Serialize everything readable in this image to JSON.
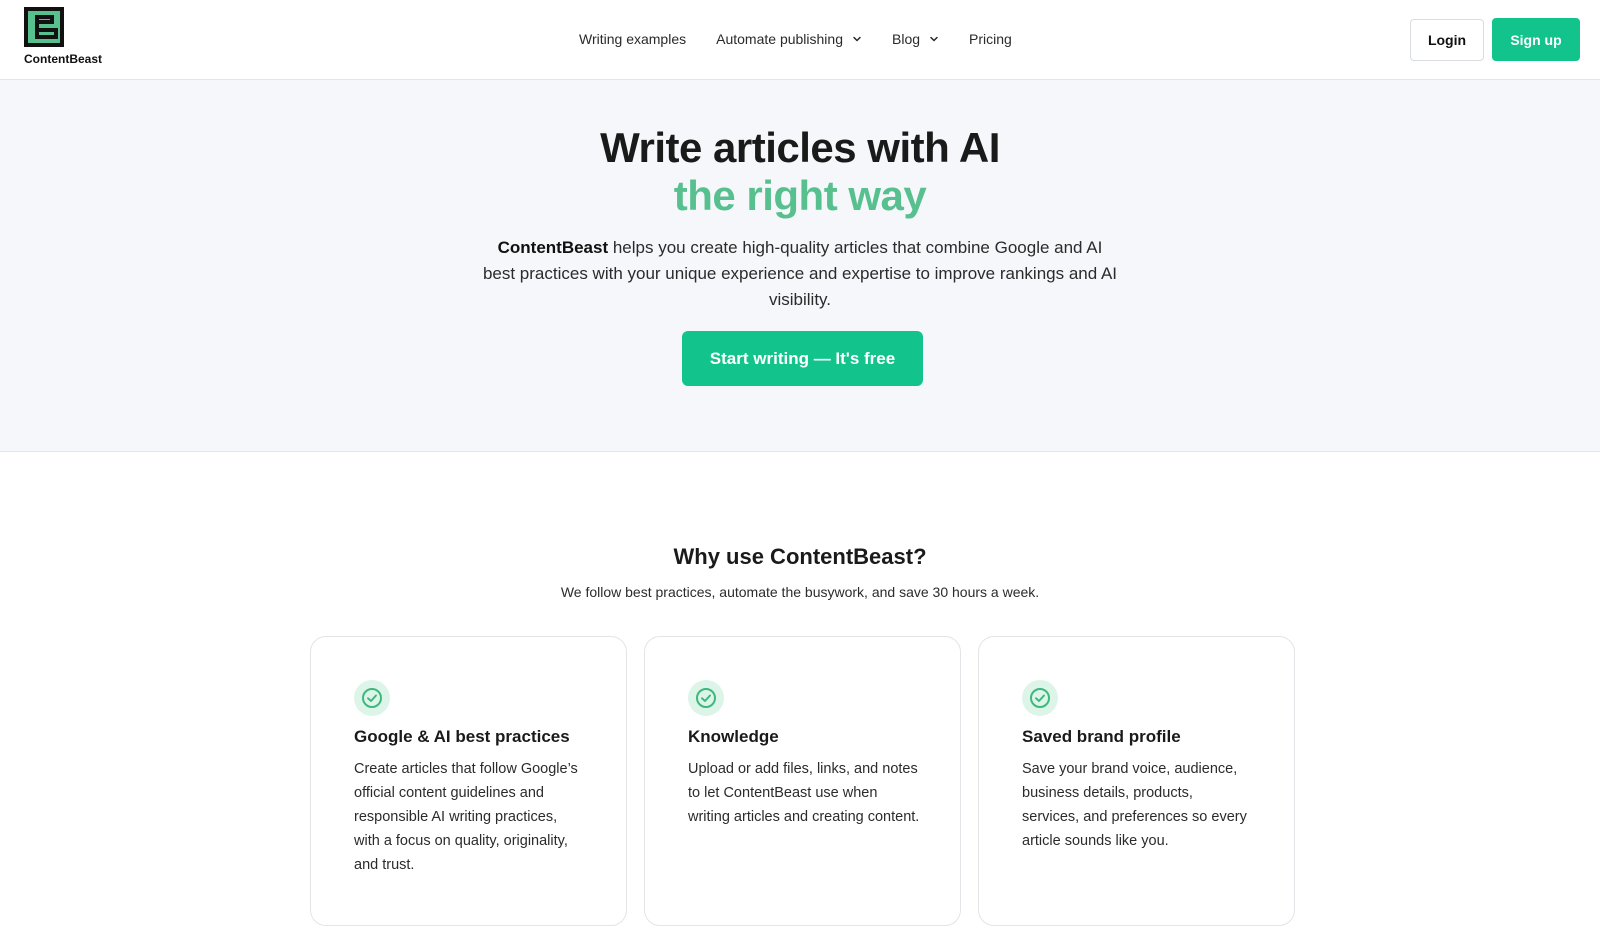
{
  "brand": {
    "name": "ContentBeast",
    "color": "#12c48b",
    "logo_icon": "contentbeast-logo-icon"
  },
  "nav": {
    "items": [
      {
        "label": "Writing examples",
        "has_dropdown": false
      },
      {
        "label": "Automate publishing",
        "has_dropdown": true
      },
      {
        "label": "Blog",
        "has_dropdown": true
      },
      {
        "label": "Pricing",
        "has_dropdown": false
      }
    ],
    "login_label": "Login",
    "signup_label": "Sign up"
  },
  "hero": {
    "title": "Write articles with AI",
    "subtitle": "the right way",
    "subtitle_color": "#58c08f",
    "description_brand": "ContentBeast",
    "description_rest": " helps you create high-quality articles that combine Google and AI best practices with your unique experience and expertise to improve rankings and AI visibility.",
    "cta_label": "Start writing — It's free"
  },
  "why": {
    "title": "Why use ContentBeast?",
    "subtitle": "We follow best practices, automate the busywork, and save 30 hours a week.",
    "cards": [
      {
        "icon": "check-circle-icon",
        "title": "Google & AI best practices",
        "text": "Create articles that follow Google’s official content guidelines and responsible AI writing practices, with a focus on quality, originality, and trust."
      },
      {
        "icon": "check-circle-icon",
        "title": "Knowledge",
        "text": "Upload or add files, links, and notes to let ContentBeast use when writing articles and creating content."
      },
      {
        "icon": "check-circle-icon",
        "title": "Saved brand profile",
        "text": "Save your brand voice, audience, business details, products, services, and preferences so every article sounds like you."
      }
    ]
  }
}
